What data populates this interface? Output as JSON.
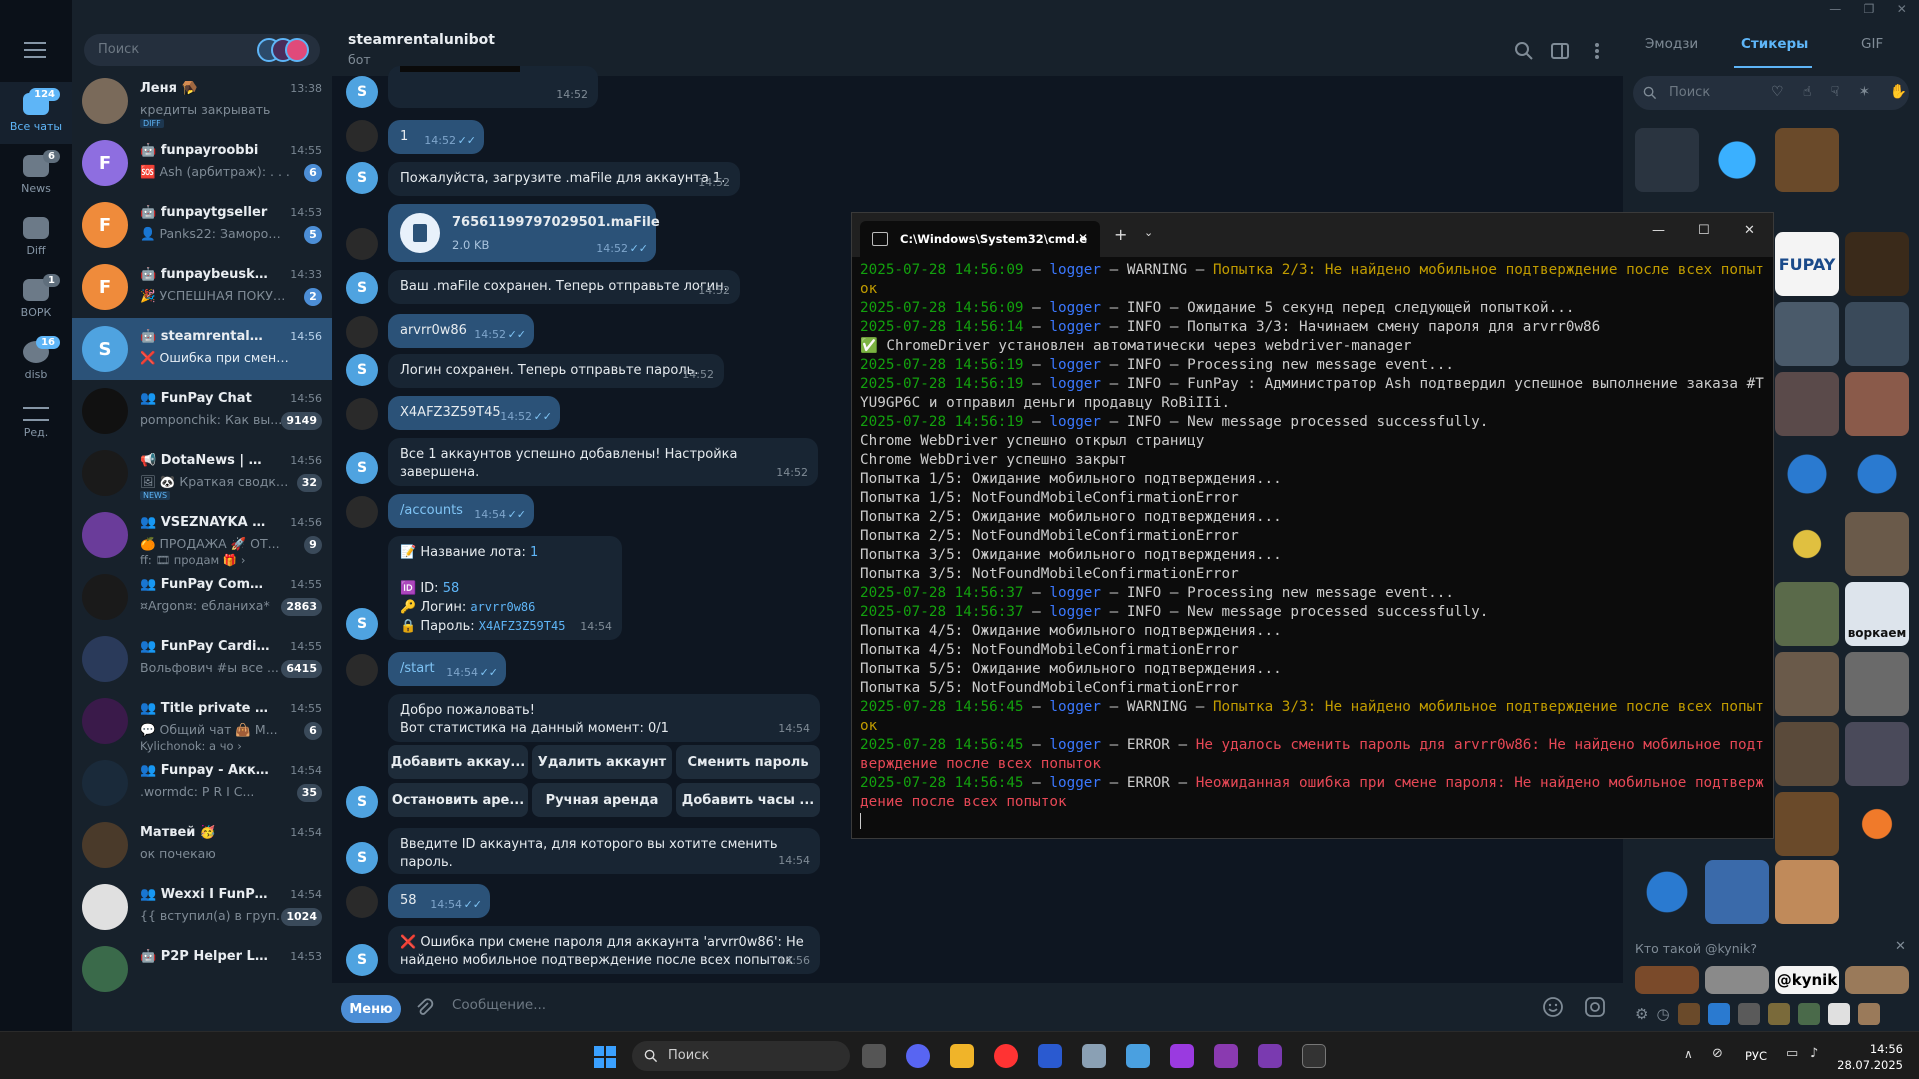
{
  "rail": {
    "items": [
      {
        "label": "Все чаты",
        "badge": "124"
      },
      {
        "label": "News",
        "badge": "6"
      },
      {
        "label": "Diff",
        "badge": ""
      },
      {
        "label": "ВОРК",
        "badge": "1"
      },
      {
        "label": "disb",
        "badge": "16"
      },
      {
        "label": "Ред.",
        "badge": ""
      }
    ]
  },
  "chatlist": {
    "search_placeholder": "Поиск",
    "chats": [
      {
        "name": "Леня 🪤",
        "time": "13:38",
        "preview": "кредиты закрывать",
        "badge": "",
        "tag": "DIFF",
        "avatar_color": "#7a6a5a",
        "initial": ""
      },
      {
        "name": "🤖 funpayroobbi",
        "time": "14:55",
        "preview": "🆘 Ash (арбитраж): . . .",
        "badge": "6",
        "tag": "",
        "avatar_color": "#8e6ee0",
        "initial": "F"
      },
      {
        "name": "🤖 funpaytgseller",
        "time": "14:53",
        "preview": "👤 Panks22: Заморож...",
        "badge": "5",
        "tag": "",
        "avatar_color": "#ef8b3b",
        "initial": "F"
      },
      {
        "name": "🤖 funpaybeuskapbot",
        "time": "14:33",
        "preview": "🎉 УСПЕШНАЯ ПОКУПК...",
        "badge": "2",
        "tag": "",
        "avatar_color": "#ef8b3b",
        "initial": "F"
      },
      {
        "name": "🤖 steamrentalunibot",
        "time": "14:56",
        "preview": "❌ Ошибка при смене пар...",
        "badge": "",
        "tag": "",
        "avatar_color": "#4fa3e0",
        "initial": "S"
      },
      {
        "name": "👥 FunPay Chat",
        "time": "14:56",
        "preview": "pomponchik: Как вы...",
        "badge": "9149",
        "tag": "",
        "avatar_color": "#111111",
        "initial": ""
      },
      {
        "name": "📢 DotaNews | Dota 2",
        "time": "14:56",
        "preview": "🖼 🐼 Краткая сводка ...",
        "badge": "32",
        "tag": "NEWS",
        "avatar_color": "#1a1a1a",
        "initial": ""
      },
      {
        "name": "👥 VSEZNAYKA OTC /...",
        "time": "14:56",
        "preview": "🍊 ПРОДАЖА 🚀 ОТ...",
        "badge": "9",
        "tag": "",
        "avatar_color": "#6a3c9a",
        "initial": ""
      },
      {
        "name": "👥 FunPay Communit...",
        "time": "14:55",
        "preview": "¤Argon¤: ебланиха*",
        "badge": "2863",
        "tag": "",
        "avatar_color": "#1a1a1a",
        "initial": ""
      },
      {
        "name": "👥 FunPay Cardinal",
        "time": "14:55",
        "preview": "Вольфович #ы все ...",
        "badge": "6415",
        "tag": "",
        "avatar_color": "#2a3a5a",
        "initial": ""
      },
      {
        "name": "👥 Title private | Car...",
        "time": "14:55",
        "preview": "💬 Общий чат 👜 М...",
        "badge": "6",
        "tag": "",
        "avatar_color": "#3a1a4a",
        "initial": ""
      },
      {
        "name": "👥 Funpay - Аккаунт...",
        "time": "14:54",
        "preview": ".wormdc: P R I C...",
        "badge": "35",
        "tag": "",
        "avatar_color": "#1a2a3a",
        "initial": ""
      },
      {
        "name": "Матвей 🥳",
        "time": "14:54",
        "preview": "ок почекаю",
        "badge": "",
        "tag": "",
        "avatar_color": "#4a3a2a",
        "initial": ""
      },
      {
        "name": "👥 Wexxi I FunPay Chat",
        "time": "14:54",
        "preview": "{{ вступил(а) в групп...",
        "badge": "1024",
        "tag": "",
        "avatar_color": "#e0e0e0",
        "initial": ""
      },
      {
        "name": "🤖 P2P Helper LZT ⚡",
        "time": "14:53",
        "preview": "",
        "badge": "",
        "tag": "",
        "avatar_color": "#3a6a4a",
        "initial": ""
      }
    ],
    "extra_line": "ff: 🎞 продам 🎁 ›",
    "extra_line2": "Kylichonok: а чо ›"
  },
  "chat": {
    "peer_name": "steamrentalunibot",
    "peer_status": "бот",
    "messages": [
      {
        "side": "in",
        "text": "",
        "time": "14:52"
      },
      {
        "side": "out",
        "text": "1",
        "time": "14:52"
      },
      {
        "side": "in",
        "text": "Пожалуйста, загрузите .maFile для аккаунта 1.",
        "time": "14:52"
      },
      {
        "side": "out",
        "text": "76561199797029501.maFile",
        "sub": "2.0 KB",
        "time": "14:52"
      },
      {
        "side": "in",
        "text": "Ваш .maFile сохранен. Теперь отправьте логин.",
        "time": "14:52"
      },
      {
        "side": "out",
        "text": "arvrr0w86",
        "time": "14:52"
      },
      {
        "side": "in",
        "text": "Логин сохранен. Теперь отправьте пароль.",
        "time": "14:52"
      },
      {
        "side": "out",
        "text": "X4AFZ3Z59T45",
        "time": "14:52"
      },
      {
        "side": "in",
        "text": "Все 1 аккаунтов успешно добавлены! Настройка завершена.",
        "time": "14:52"
      },
      {
        "side": "out",
        "text": "/accounts",
        "time": "14:54"
      },
      {
        "side": "in",
        "lot_label": "📝 Название лота: ",
        "lot_value": "1",
        "id_label": "🆔 ID: ",
        "id_value": "58",
        "login_label": "🔑 Логин: ",
        "login_value": "arvrr0w86",
        "pass_label": "🔒 Пароль: ",
        "pass_value": "X4AFZ3Z59T45",
        "time": "14:54"
      },
      {
        "side": "out",
        "text": "/start",
        "time": "14:54"
      },
      {
        "side": "in",
        "text": "Добро пожаловать!",
        "text2": "Вот статистика на данный момент: 0/1",
        "time": "14:54"
      },
      {
        "side": "in",
        "text": "Введите ID аккаунта, для которого вы хотите сменить пароль.",
        "time": "14:54"
      },
      {
        "side": "out",
        "text": "58",
        "time": "14:54"
      },
      {
        "side": "in",
        "text": "❌ Ошибка при смене пароля для аккаунта 'arvrr0w86': Не",
        "text2": "найдено мобильное подтверждение после всех попыток",
        "time": "14:56"
      }
    ],
    "keyboard": [
      "Добавить аккау...",
      "Удалить аккаунт",
      "Сменить пароль",
      "Остановить аре...",
      "Ручная аренда",
      "Добавить часы ..."
    ],
    "menu_label": "Меню",
    "input_placeholder": "Сообщение..."
  },
  "cmd": {
    "tab_title": "C:\\Windows\\System32\\cmd.e",
    "lines": [
      [
        [
          "g",
          "2025-07-28 14:56:09"
        ],
        [
          "w",
          " – "
        ],
        [
          "b",
          "logger"
        ],
        [
          "w",
          " – WARNING – "
        ],
        [
          "y",
          "Попытка 2/3: Не найдено мобильное подтверждение после всех попыток"
        ]
      ],
      [
        [
          "g",
          "2025-07-28 14:56:09"
        ],
        [
          "w",
          " – "
        ],
        [
          "b",
          "logger"
        ],
        [
          "w",
          " – INFO – Ожидание 5 секунд перед следующей попыткой..."
        ]
      ],
      [
        [
          "g",
          "2025-07-28 14:56:14"
        ],
        [
          "w",
          " – "
        ],
        [
          "b",
          "logger"
        ],
        [
          "w",
          " – INFO – Попытка 3/3: Начинаем смену пароля для arvrr0w86"
        ]
      ],
      [
        [
          "g",
          "✅"
        ],
        [
          "w",
          " ChromeDriver установлен автоматически через webdriver-manager"
        ]
      ],
      [
        [
          "g",
          "2025-07-28 14:56:19"
        ],
        [
          "w",
          " – "
        ],
        [
          "b",
          "logger"
        ],
        [
          "w",
          " – INFO – Processing new message event..."
        ]
      ],
      [
        [
          "g",
          "2025-07-28 14:56:19"
        ],
        [
          "w",
          " – "
        ],
        [
          "b",
          "logger"
        ],
        [
          "w",
          " – INFO – FunPay : Администратор Ash подтвердил успешное выполнение заказа #TYU9GP6C и отправил деньги продавцу RoBiIIi."
        ]
      ],
      [
        [
          "g",
          "2025-07-28 14:56:19"
        ],
        [
          "w",
          " – "
        ],
        [
          "b",
          "logger"
        ],
        [
          "w",
          " – INFO – New message processed successfully."
        ]
      ],
      [
        [
          "w",
          "Chrome WebDriver успешно открыл страницу"
        ]
      ],
      [
        [
          "w",
          "Chrome WebDriver успешно закрыт"
        ]
      ],
      [
        [
          "w",
          "Попытка 1/5: Ожидание мобильного подтверждения..."
        ]
      ],
      [
        [
          "w",
          "Попытка 1/5: NotFoundMobileConfirmationError"
        ]
      ],
      [
        [
          "w",
          "Попытка 2/5: Ожидание мобильного подтверждения..."
        ]
      ],
      [
        [
          "w",
          "Попытка 2/5: NotFoundMobileConfirmationError"
        ]
      ],
      [
        [
          "w",
          "Попытка 3/5: Ожидание мобильного подтверждения..."
        ]
      ],
      [
        [
          "w",
          "Попытка 3/5: NotFoundMobileConfirmationError"
        ]
      ],
      [
        [
          "g",
          "2025-07-28 14:56:37"
        ],
        [
          "w",
          " – "
        ],
        [
          "b",
          "logger"
        ],
        [
          "w",
          " – INFO – Processing new message event..."
        ]
      ],
      [
        [
          "g",
          "2025-07-28 14:56:37"
        ],
        [
          "w",
          " – "
        ],
        [
          "b",
          "logger"
        ],
        [
          "w",
          " – INFO – New message processed successfully."
        ]
      ],
      [
        [
          "w",
          "Попытка 4/5: Ожидание мобильного подтверждения..."
        ]
      ],
      [
        [
          "w",
          "Попытка 4/5: NotFoundMobileConfirmationError"
        ]
      ],
      [
        [
          "w",
          "Попытка 5/5: Ожидание мобильного подтверждения..."
        ]
      ],
      [
        [
          "w",
          "Попытка 5/5: NotFoundMobileConfirmationError"
        ]
      ],
      [
        [
          "g",
          "2025-07-28 14:56:45"
        ],
        [
          "w",
          " – "
        ],
        [
          "b",
          "logger"
        ],
        [
          "w",
          " – WARNING – "
        ],
        [
          "y",
          "Попытка 3/3: Не найдено мобильное подтверждение после всех попыток"
        ]
      ],
      [
        [
          "g",
          "2025-07-28 14:56:45"
        ],
        [
          "w",
          " – "
        ],
        [
          "b",
          "logger"
        ],
        [
          "w",
          " – ERROR – "
        ],
        [
          "r",
          "Не удалось сменить пароль для arvrr0w86: Не найдено мобильное подтверждение после всех попыток"
        ]
      ],
      [
        [
          "g",
          "2025-07-28 14:56:45"
        ],
        [
          "w",
          " – "
        ],
        [
          "b",
          "logger"
        ],
        [
          "w",
          " – ERROR – "
        ],
        [
          "r",
          "Неожиданная ошибка при смене пароля: Не найдено мобильное подтверждение после всех попыток"
        ]
      ]
    ]
  },
  "stickers": {
    "tabs": [
      "Эмодзи",
      "Стикеры",
      "GIF"
    ],
    "search_placeholder": "Поиск",
    "pack_label": "Кто такой @kynik?",
    "kynik_text": "@kynik",
    "labels": [
      "FUPAY",
      "ворка",
      "воркаем"
    ]
  },
  "taskbar": {
    "search_placeholder": "Поиск",
    "lang": "РУС",
    "time": "14:56",
    "date": "28.07.2025"
  },
  "colors": {
    "accent": "#5eb5f7",
    "active_chat": "#2b5278",
    "out_bubble": "#2b5278",
    "in_bubble": "#182533"
  }
}
